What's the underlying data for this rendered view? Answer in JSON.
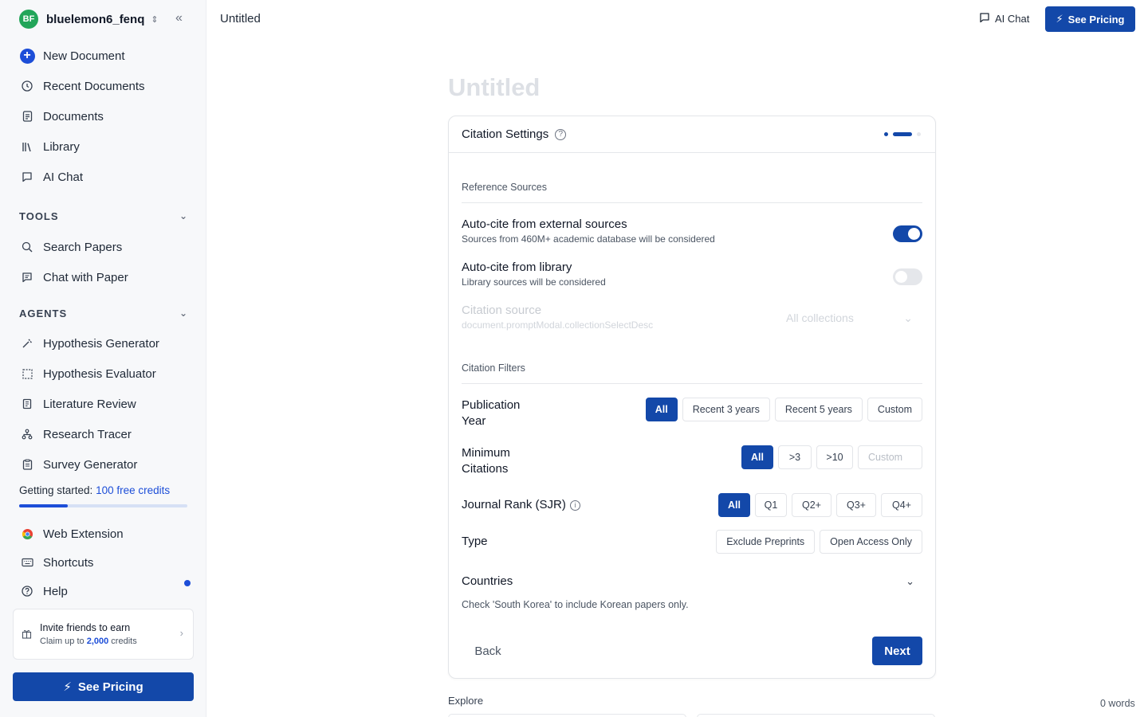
{
  "user": {
    "initials": "BF",
    "name": "bluelemon6_fenq"
  },
  "nav": {
    "new_document": "New Document",
    "recent_documents": "Recent Documents",
    "documents": "Documents",
    "library": "Library",
    "ai_chat": "AI Chat"
  },
  "tools": {
    "heading": "TOOLS",
    "items": [
      "Search Papers",
      "Chat with Paper"
    ]
  },
  "agents": {
    "heading": "AGENTS",
    "items": [
      "Hypothesis Generator",
      "Hypothesis Evaluator",
      "Literature Review",
      "Research Tracer",
      "Survey Generator"
    ]
  },
  "credits": {
    "prefix": "Getting started:",
    "link": "100 free credits",
    "progress": 0.29
  },
  "footer_nav": {
    "web_extension": "Web Extension",
    "shortcuts": "Shortcuts",
    "help": "Help"
  },
  "invite": {
    "title": "Invite friends to earn",
    "prefix": "Claim up to",
    "amount": "2,000",
    "suffix": "credits"
  },
  "pricing_label": "See Pricing",
  "topbar": {
    "doc_title": "Untitled",
    "ai_chat": "AI Chat",
    "pricing": "See Pricing"
  },
  "editor": {
    "title": "Untitled",
    "explore": "Explore",
    "word_count": "0 words"
  },
  "citation": {
    "title": "Citation Settings",
    "reference_sources": "Reference Sources",
    "external": {
      "label": "Auto-cite from external sources",
      "desc": "Sources from 460M+ academic database will be considered",
      "on": true
    },
    "library": {
      "label": "Auto-cite from library",
      "desc": "Library sources will be considered",
      "on": false
    },
    "source": {
      "label": "Citation source",
      "desc": "document.promptModal.collectionSelectDesc",
      "select": "All collections"
    },
    "filters_heading": "Citation Filters",
    "pub_year": {
      "label_1": "Publication",
      "label_2": "Year",
      "options": [
        "All",
        "Recent 3 years",
        "Recent 5 years",
        "Custom"
      ],
      "selected": "All"
    },
    "min_citations": {
      "label_1": "Minimum",
      "label_2": "Citations",
      "options": [
        "All",
        ">3",
        ">10"
      ],
      "custom_placeholder": "Custom",
      "selected": "All"
    },
    "journal_rank": {
      "label": "Journal Rank (SJR)",
      "options": [
        "All",
        "Q1",
        "Q2+",
        "Q3+",
        "Q4+"
      ],
      "selected": "All"
    },
    "type": {
      "label": "Type",
      "options": [
        "Exclude Preprints",
        "Open Access Only"
      ]
    },
    "countries": {
      "label": "Countries",
      "hint": "Check 'South Korea' to include Korean papers only."
    },
    "back": "Back",
    "next": "Next"
  },
  "colors": {
    "primary": "#1348a9",
    "avatar": "#22a559",
    "sidebar_bg": "#f7f8fa"
  }
}
